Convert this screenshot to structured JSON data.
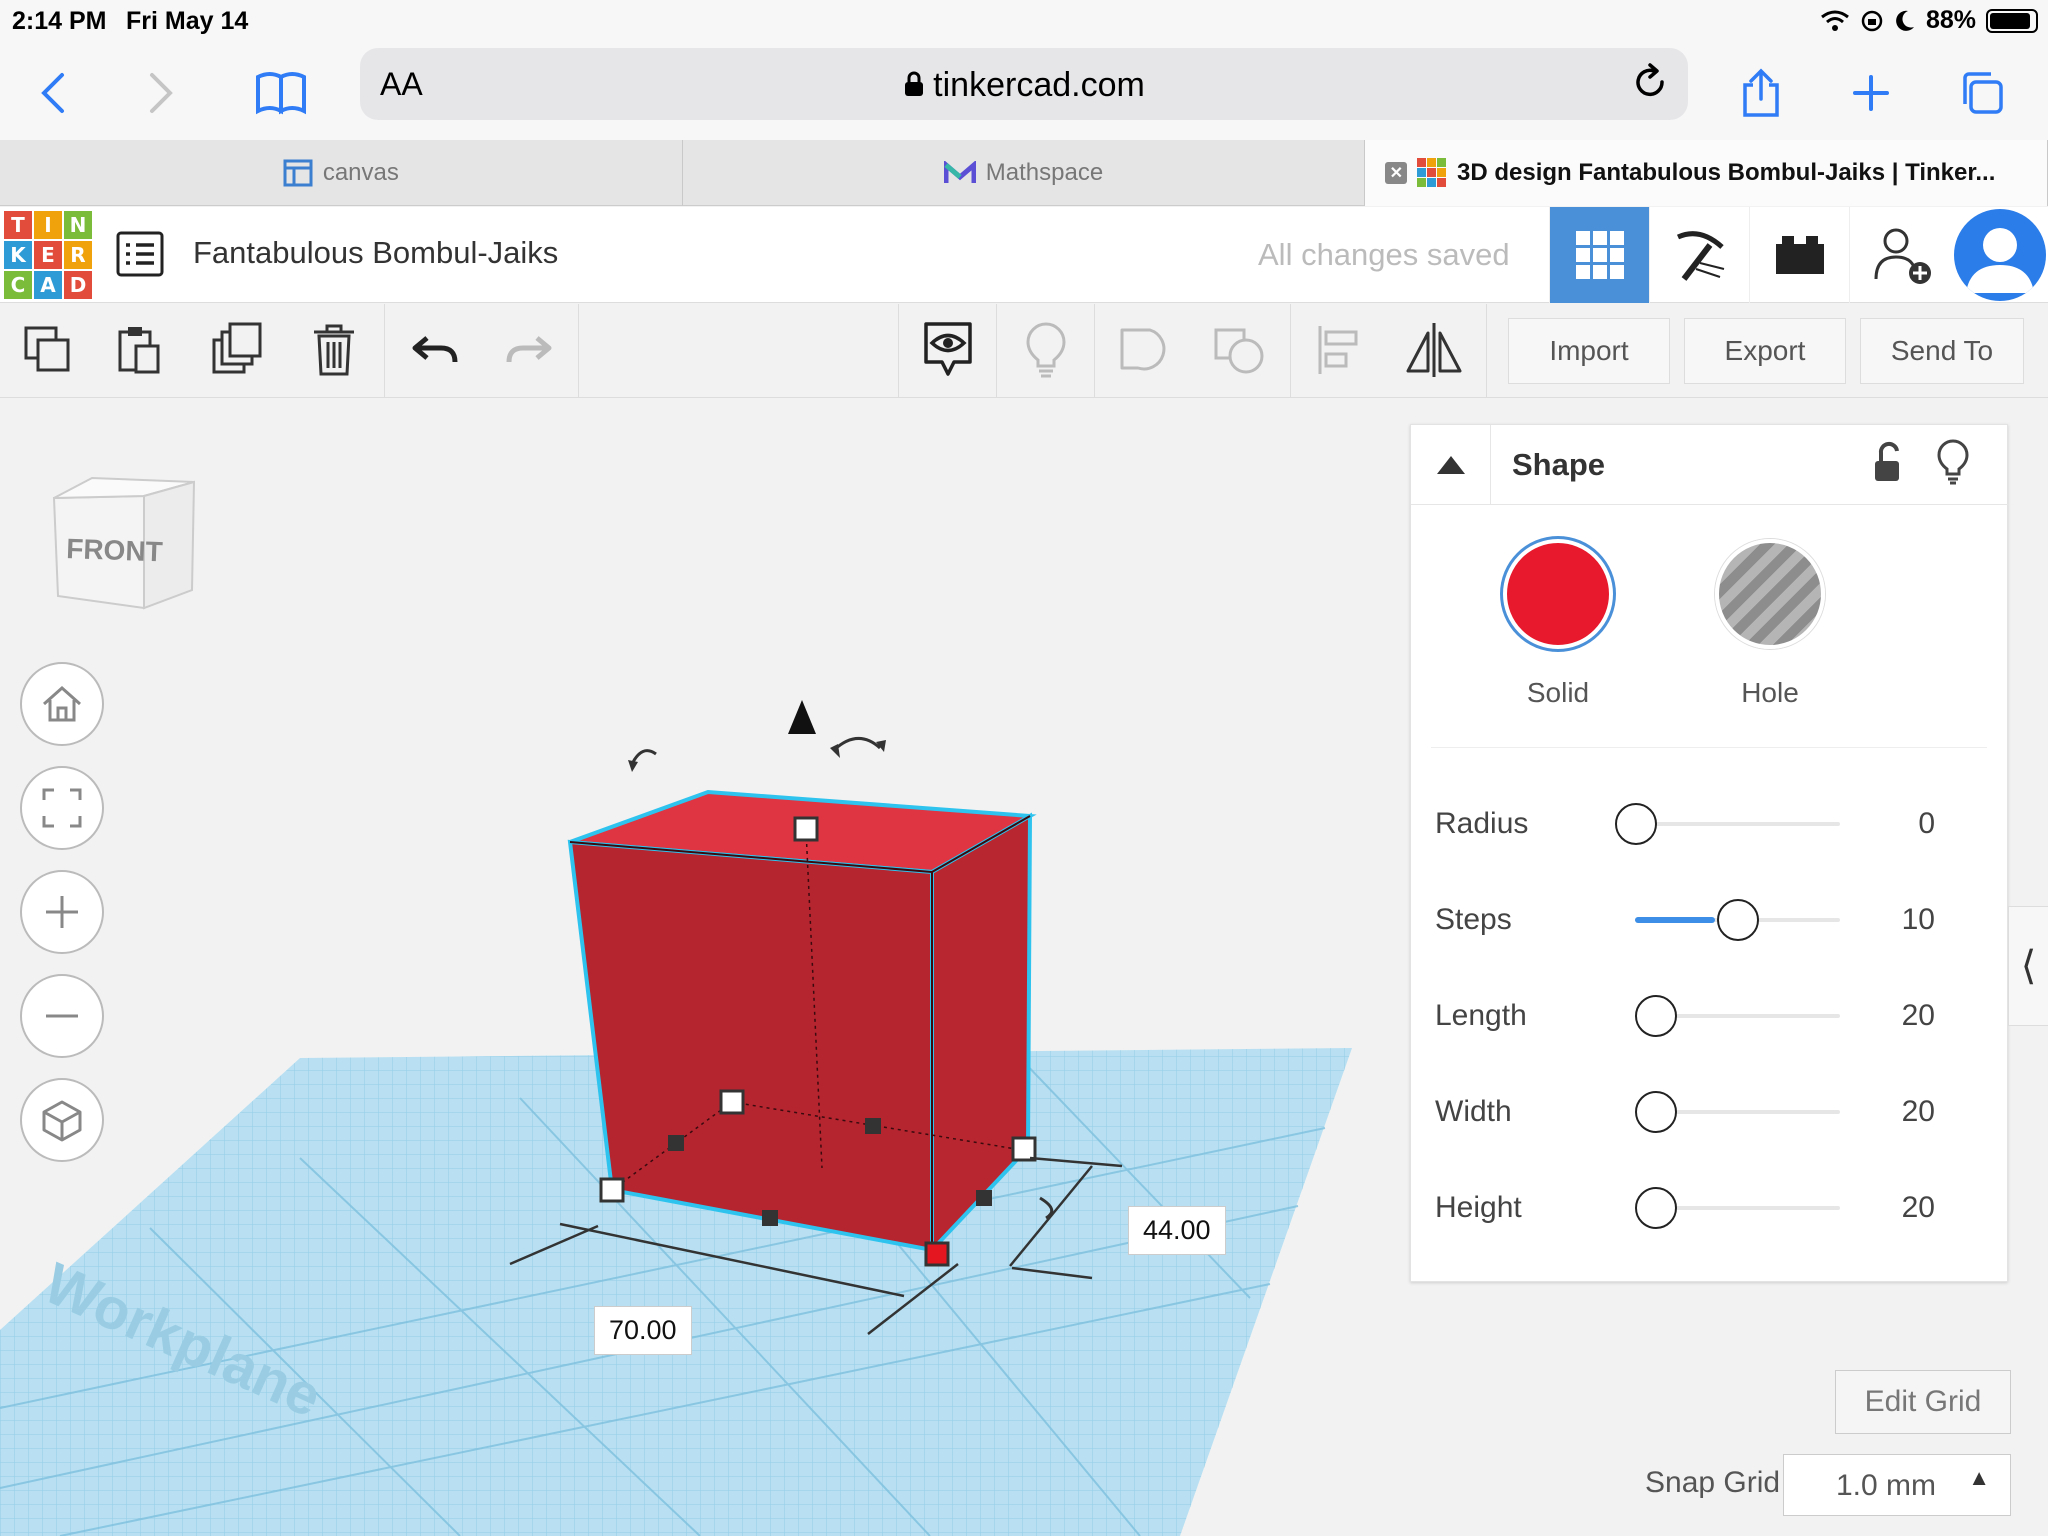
{
  "status_bar": {
    "time": "2:14 PM",
    "date": "Fri May 14",
    "battery": "88%"
  },
  "browser": {
    "text_size_label": "AA",
    "url": "tinkercad.com",
    "tabs": [
      {
        "label": "canvas"
      },
      {
        "label": "Mathspace"
      },
      {
        "label": "3D design Fantabulous Bombul-Jaiks | Tinker..."
      }
    ]
  },
  "header": {
    "logo_letters": [
      "T",
      "I",
      "N",
      "K",
      "E",
      "R",
      "C",
      "A",
      "D"
    ],
    "design_title": "Fantabulous Bombul-Jaiks",
    "save_status": "All changes saved"
  },
  "toolbar": {
    "import_label": "Import",
    "export_label": "Export",
    "send_to_label": "Send To"
  },
  "viewcube": {
    "face_label": "FRONT"
  },
  "workplane": {
    "label": "Workplane"
  },
  "dimensions": {
    "length": "70.00",
    "width": "44.00"
  },
  "shape_panel": {
    "title": "Shape",
    "solid_label": "Solid",
    "hole_label": "Hole",
    "solid_color": "#e8192c",
    "properties": [
      {
        "label": "Radius",
        "value": "0",
        "fraction": 0.0
      },
      {
        "label": "Steps",
        "value": "10",
        "fraction": 0.5
      },
      {
        "label": "Length",
        "value": "20",
        "fraction": 0.0
      },
      {
        "label": "Width",
        "value": "20",
        "fraction": 0.0
      },
      {
        "label": "Height",
        "value": "20",
        "fraction": 0.0
      }
    ]
  },
  "grid_controls": {
    "edit_grid_label": "Edit Grid",
    "snap_grid_label": "Snap Grid",
    "snap_grid_value": "1.0 mm"
  },
  "colors": {
    "accent": "#4a90d9",
    "shape_red": "#c8232f",
    "workplane": "#a8d8ee"
  }
}
